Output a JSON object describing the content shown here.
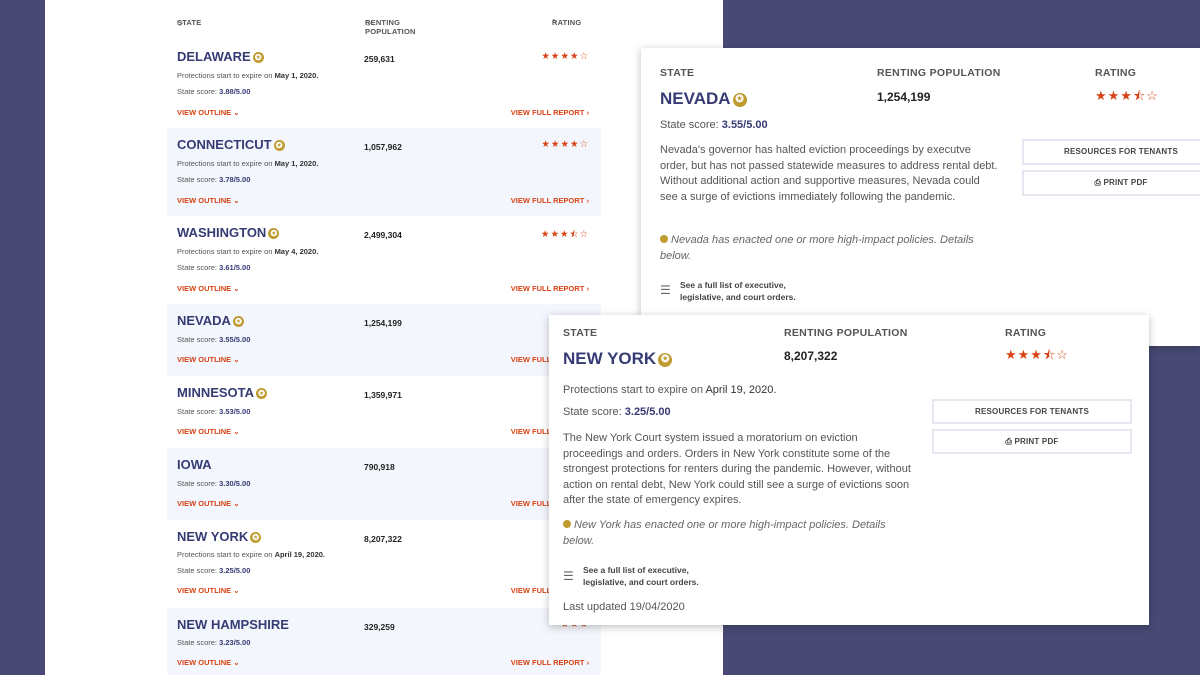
{
  "list": {
    "headers": {
      "state": "STATE",
      "state_sym": "◇",
      "population": "RENTING POPULATION",
      "population_sym": "◇",
      "rating": "RATING",
      "rating_sym": "^"
    },
    "star_icon": "✪",
    "view_outline": "VIEW OUTLINE",
    "view_outline_icon": "⌄",
    "view_report": "VIEW FULL REPORT",
    "view_report_icon": "›",
    "rows": [
      {
        "state": "DELAWARE",
        "population": "259,631",
        "stars": "★★★★☆",
        "note_prefix": "Protections start to expire on ",
        "note_date": "May 1, 2020.",
        "score_prefix": "State score: ",
        "score": "3.88/5.00"
      },
      {
        "state": "CONNECTICUT",
        "population": "1,057,962",
        "stars": "★★★★☆",
        "note_prefix": "Protections start to expire on ",
        "note_date": "May 1, 2020.",
        "score_prefix": "State score: ",
        "score": "3.78/5.00"
      },
      {
        "state": "WASHINGTON",
        "population": "2,499,304",
        "stars": "★★★⯪☆",
        "note_prefix": "Protections start to expire on ",
        "note_date": "May 4, 2020.",
        "score_prefix": "State score: ",
        "score": "3.61/5.00"
      },
      {
        "state": "NEVADA",
        "population": "1,254,199",
        "stars": "★",
        "score_prefix": "State score: ",
        "score": "3.55/5.00"
      },
      {
        "state": "MINNESOTA",
        "population": "1,359,971",
        "stars": "★",
        "score_prefix": "State score: ",
        "score": "3.53/5.00"
      },
      {
        "state": "IOWA",
        "population": "790,918",
        "stars": "★",
        "score_prefix": "State score: ",
        "score": "3.30/5.00"
      },
      {
        "state": "NEW YORK",
        "population": "8,207,322",
        "stars": "★",
        "note_prefix": "Protections start to expire on ",
        "note_date": "April 19, 2020.",
        "score_prefix": "State score: ",
        "score": "3.25/5.00"
      },
      {
        "state": "NEW HAMPSHIRE",
        "population": "329,259",
        "stars": "★★★",
        "score_prefix": "State score: ",
        "score": "3.23/5.00"
      }
    ]
  },
  "nevada_card": {
    "state_label": "STATE",
    "population_label": "RENTING POPULATION",
    "rating_label": "RATING",
    "state": "NEVADA",
    "population": "1,254,199",
    "stars": "★★★⯪☆",
    "score_prefix": "State score: ",
    "score": "3.55/5.00",
    "description": "Nevada's governor has halted eviction proceedings by executve order, but has not passed statewide measures to address rental debt. Without additional action and supportive measures, Nevada could see a surge of evictions immediately following the pandemic.",
    "highlight": "Nevada has enacted one or more high-impact policies. Details below.",
    "list_link": "See a full list of executive, legislative, and court orders.",
    "list_icon": "☰",
    "resources_button": "RESOURCES FOR TENANTS",
    "print_button": "PRINT PDF",
    "print_icon": "⎙"
  },
  "newyork_card": {
    "state_label": "STATE",
    "population_label": "RENTING POPULATION",
    "rating_label": "RATING",
    "state": "NEW YORK",
    "population": "8,207,322",
    "stars": "★★★⯪☆",
    "expire_prefix": "Protections start to expire on ",
    "expire_date": "April 19, 2020.",
    "score_prefix": "State score: ",
    "score": "3.25/5.00",
    "description": "The New York Court system issued a moratorium on eviction proceedings and orders. Orders in New York constitute some of the strongest protections for renters during the pandemic. However, without action on rental debt, New York could still see a surge of evictions soon after the state of emergency expires.",
    "highlight": "New York has enacted one or more high-impact policies. Details below.",
    "list_link": "See a full list of executive, legislative, and court orders.",
    "list_icon": "☰",
    "updated": "Last updated 19/04/2020",
    "resources_button": "RESOURCES FOR TENANTS",
    "print_button": "PRINT PDF",
    "print_icon": "⎙"
  },
  "colors": {
    "background": "#484a75",
    "accent": "#d84315",
    "state_text": "#373b74",
    "badge": "#bf9b30"
  }
}
